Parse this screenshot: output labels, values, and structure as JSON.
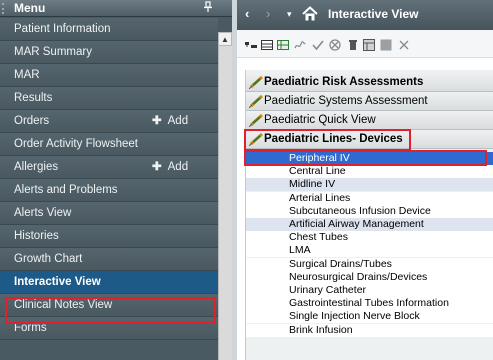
{
  "menu": {
    "title": "Menu",
    "pin_icon": "pin-icon",
    "items": [
      {
        "label": "Patient Information"
      },
      {
        "label": "MAR Summary"
      },
      {
        "label": "MAR"
      },
      {
        "label": "Results"
      },
      {
        "label": "Orders",
        "action": "Add"
      },
      {
        "label": "Order Activity Flowsheet"
      },
      {
        "label": "Allergies",
        "action": "Add"
      },
      {
        "label": "Alerts and Problems"
      },
      {
        "label": "Alerts View"
      },
      {
        "label": "Histories"
      },
      {
        "label": "Growth Chart"
      },
      {
        "label": "Interactive View",
        "selected": true
      },
      {
        "label": "Clinical Notes View"
      },
      {
        "label": "Forms"
      }
    ]
  },
  "view": {
    "title": "Interactive View",
    "nav": {
      "back": "‹",
      "forward": "›",
      "dropdown": "▾"
    }
  },
  "toolbar": {
    "icons": [
      "expand-icon",
      "table-icon",
      "flowsheet-icon",
      "signature-icon",
      "checkmark-icon",
      "unchart-icon",
      "delete-icon",
      "grid-icon",
      "block-icon",
      "close-icon"
    ]
  },
  "bands": [
    {
      "label": "Paediatric Risk Assessments",
      "bold": true
    },
    {
      "label": "Paediatric Systems Assessment",
      "bold": false
    },
    {
      "label": "Paediatric Quick View",
      "bold": false
    },
    {
      "label": "Paediatric Lines- Devices",
      "bold": true
    }
  ],
  "sections": [
    {
      "label": "Peripheral IV",
      "state": "selected"
    },
    {
      "label": "Central Line",
      "state": "plain"
    },
    {
      "label": "Midline IV",
      "state": "shaded"
    },
    {
      "label": "Arterial Lines",
      "state": "plain"
    },
    {
      "label": "Subcutaneous Infusion Device",
      "state": "plain"
    },
    {
      "label": "Artificial Airway Management",
      "state": "shaded"
    },
    {
      "label": "Chest Tubes",
      "state": "plain"
    },
    {
      "label": "LMA",
      "state": "plain"
    },
    {
      "label": "Surgical Drains/Tubes",
      "state": "plain"
    },
    {
      "label": "Neurosurgical Drains/Devices",
      "state": "plain"
    },
    {
      "label": "Urinary Catheter",
      "state": "plain"
    },
    {
      "label": "Gastrointestinal Tubes Information",
      "state": "plain"
    },
    {
      "label": "Single Injection Nerve Block",
      "state": "plain"
    },
    {
      "label": "Brink Infusion",
      "state": "plain"
    }
  ],
  "colors": {
    "menu_bg": "#4a5a63",
    "menu_selected": "#1e5a87",
    "section_selected": "#2e6ad0",
    "section_shaded": "#dde3ef",
    "highlight_red": "#e0202a"
  }
}
